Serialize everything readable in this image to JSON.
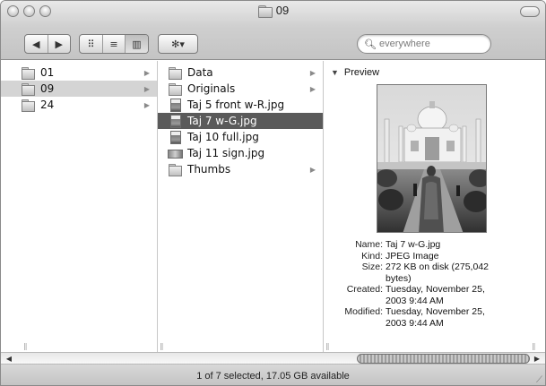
{
  "window": {
    "title": "09"
  },
  "toolbar": {
    "back_icon": "◀",
    "forward_icon": "▶",
    "view_icon_label": "⠿",
    "view_list_label": "≡",
    "view_column_label": "▥",
    "action_label": "✻▾",
    "search_placeholder": "everywhere"
  },
  "column1": {
    "items": [
      {
        "name": "01",
        "has_children": true
      },
      {
        "name": "09",
        "has_children": true,
        "selected": true
      },
      {
        "name": "24",
        "has_children": true
      }
    ]
  },
  "column2": {
    "items": [
      {
        "name": "Data",
        "icon": "folder",
        "has_children": true
      },
      {
        "name": "Originals",
        "icon": "folder",
        "has_children": true
      },
      {
        "name": "Taj 5 front w-R.jpg",
        "icon": "jpg"
      },
      {
        "name": "Taj 7 w-G.jpg",
        "icon": "jpg",
        "selected": true
      },
      {
        "name": "Taj 10 full.jpg",
        "icon": "jpg"
      },
      {
        "name": "Taj 11 sign.jpg",
        "icon": "wide"
      },
      {
        "name": "Thumbs",
        "icon": "folder",
        "has_children": true
      }
    ]
  },
  "preview": {
    "heading": "Preview",
    "name_key": "Name:",
    "name_val": "Taj 7 w-G.jpg",
    "kind_key": "Kind:",
    "kind_val": "JPEG Image",
    "size_key": "Size:",
    "size_val_1": "272 KB on disk (275,042",
    "size_val_2": "bytes)",
    "created_key": "Created:",
    "created_val_1": "Tuesday, November 25,",
    "created_val_2": "2003 9:44 AM",
    "modified_key": "Modified:",
    "modified_val_1": "Tuesday, November 25,",
    "modified_val_2": "2003 9:44 AM"
  },
  "status": {
    "text": "1 of 7 selected, 17.05 GB available"
  }
}
